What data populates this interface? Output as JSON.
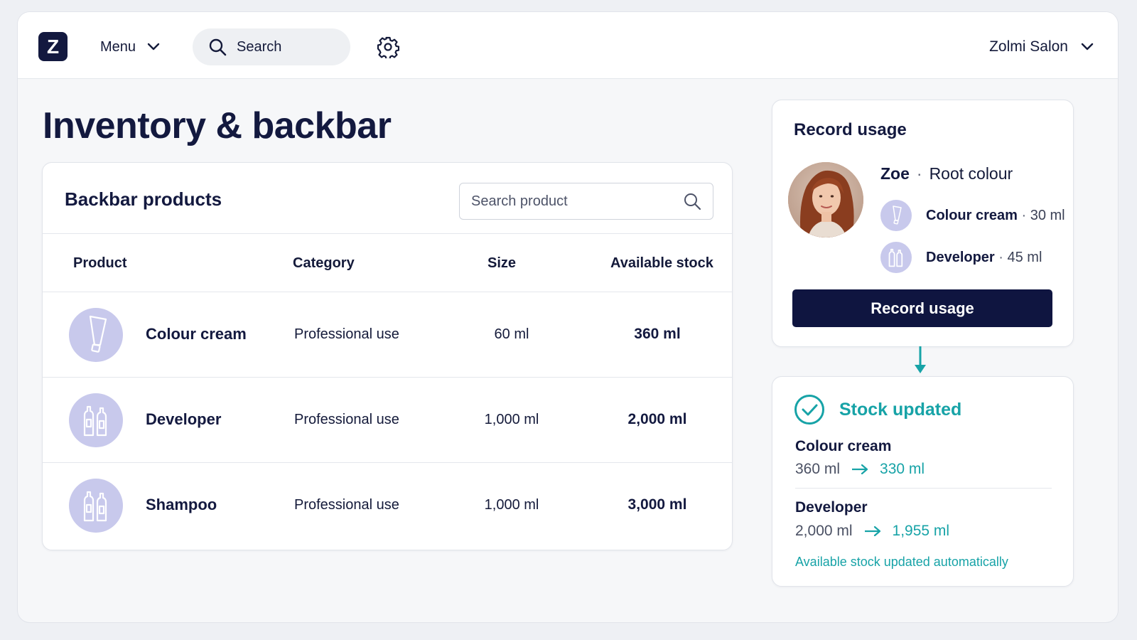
{
  "topbar": {
    "logo_letter": "Z",
    "menu_label": "Menu",
    "search_label": "Search",
    "salon_name": "Zolmi Salon"
  },
  "page": {
    "title": "Inventory & backbar"
  },
  "products": {
    "title": "Backbar products",
    "search_placeholder": "Search product",
    "columns": [
      "Product",
      "Category",
      "Size",
      "Available stock"
    ],
    "rows": [
      {
        "name": "Colour cream",
        "category": "Professional use",
        "size": "60 ml",
        "stock": "360 ml",
        "icon": "tube-icon"
      },
      {
        "name": "Developer",
        "category": "Professional use",
        "size": "1,000 ml",
        "stock": "2,000 ml",
        "icon": "bottles-icon"
      },
      {
        "name": "Shampoo",
        "category": "Professional use",
        "size": "1,000 ml",
        "stock": "3,000 ml",
        "icon": "bottles-icon"
      }
    ]
  },
  "usage": {
    "title": "Record usage",
    "client_name": "Zoe",
    "separator": "·",
    "service": "Root colour",
    "items": [
      {
        "name": "Colour cream",
        "amount": "30 ml",
        "icon": "tube-icon"
      },
      {
        "name": "Developer",
        "amount": "45 ml",
        "icon": "bottles-icon"
      }
    ],
    "button_label": "Record usage"
  },
  "stock_update": {
    "title": "Stock updated",
    "changes": [
      {
        "name": "Colour cream",
        "from": "360 ml",
        "to": "330 ml"
      },
      {
        "name": "Developer",
        "from": "2,000 ml",
        "to": "1,955 ml"
      }
    ],
    "note": "Available stock updated automatically"
  },
  "colors": {
    "brand_navy": "#13193f",
    "accent_teal": "#17a3a7",
    "icon_lavender": "#c8c9ec"
  }
}
